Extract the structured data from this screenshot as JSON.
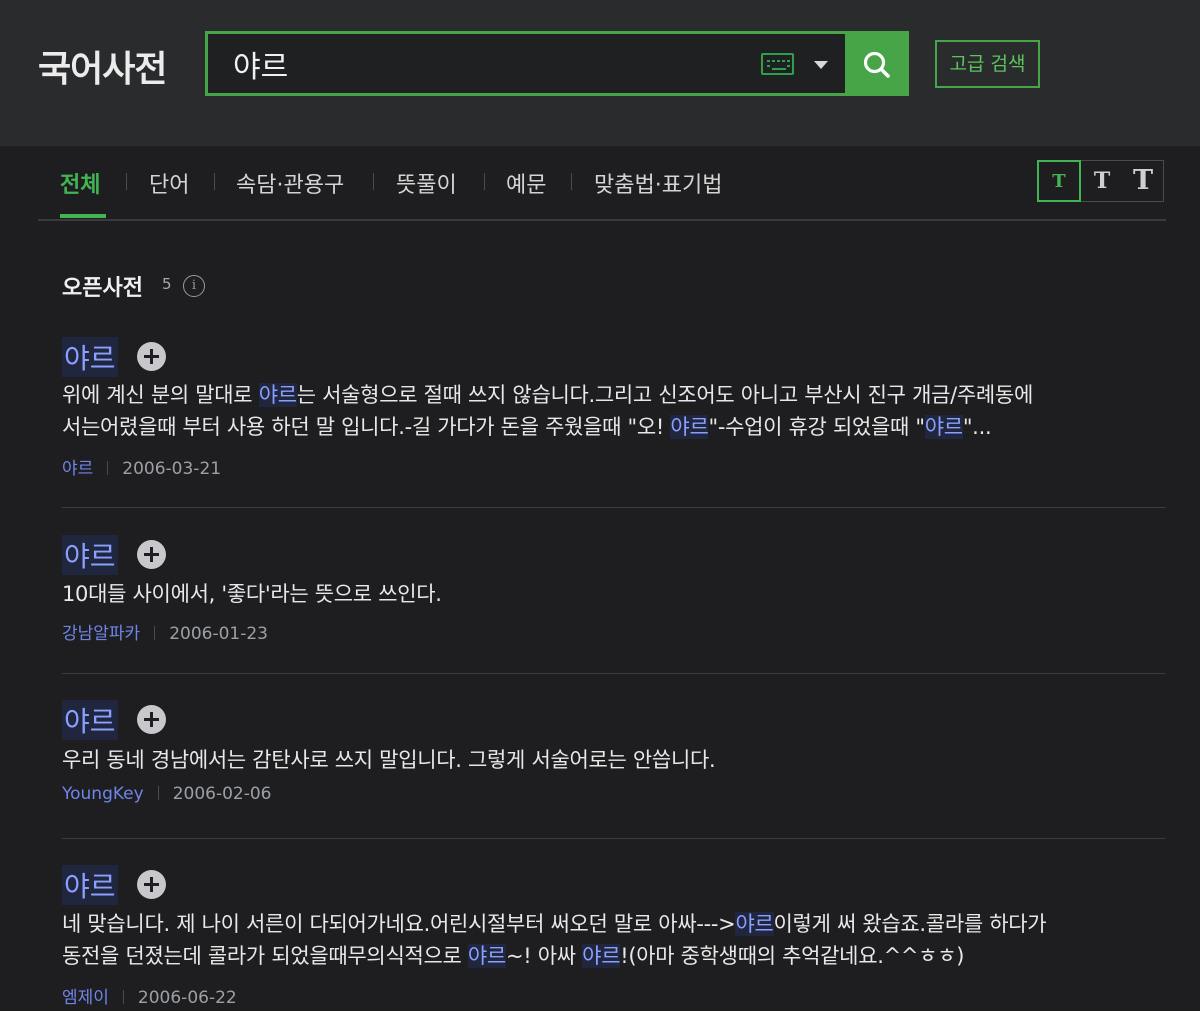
{
  "header": {
    "title": "국어사전",
    "search_value": "야르",
    "advanced_label": "고급 검색"
  },
  "tabs": [
    {
      "label": "전체",
      "active": true
    },
    {
      "label": "단어"
    },
    {
      "label": "속담·관용구"
    },
    {
      "label": "뜻풀이"
    },
    {
      "label": "예문"
    },
    {
      "label": "맞춤법·표기법"
    }
  ],
  "font_size_buttons": [
    "T",
    "T",
    "T"
  ],
  "section": {
    "title": "오픈사전",
    "count": "5",
    "info": "i"
  },
  "entries": [
    {
      "word": "야르",
      "desc_lines": [
        [
          {
            "t": "위에 계신 분의 말대로 "
          },
          {
            "t": "야르",
            "h": 1
          },
          {
            "t": "는 서술형으로 절때 쓰지 않습니다.그리고 신조어도 아니고 부산시 진구 개금/주례동에"
          }
        ],
        [
          {
            "t": "서는어렸을때 부터 사용 하던 말 입니다.-길 가다가 돈을 주웠을때 \"오! "
          },
          {
            "t": "야르",
            "h": 1
          },
          {
            "t": "\"-수업이 휴강 되었을때 \""
          },
          {
            "t": "야르",
            "h": 1
          },
          {
            "t": "\"..."
          }
        ]
      ],
      "author": "야르",
      "date": "2006-03-21"
    },
    {
      "word": "야르",
      "desc_lines": [
        [
          {
            "t": "10대들 사이에서, '좋다'라는 뜻으로 쓰인다."
          }
        ]
      ],
      "author": "강남알파카",
      "date": "2006-01-23"
    },
    {
      "word": "야르",
      "desc_lines": [
        [
          {
            "t": "우리 동네 경남에서는 감탄사로 쓰지 말입니다. 그렇게 서술어로는 안씁니다."
          }
        ]
      ],
      "author": "YoungKey",
      "date": "2006-02-06"
    },
    {
      "word": "야르",
      "desc_lines": [
        [
          {
            "t": "네 맞습니다. 제 나이 서른이 다되어가네요.어린시절부터 써오던 말로 아싸--->"
          },
          {
            "t": "야르",
            "h": 1
          },
          {
            "t": "이렇게 써 왔습죠.콜라를 하다가"
          }
        ],
        [
          {
            "t": "동전을 던졌는데 콜라가 되었을때무의식적으로 "
          },
          {
            "t": "야르",
            "h": 1
          },
          {
            "t": "~! 아싸 "
          },
          {
            "t": "야르",
            "h": 1
          },
          {
            "t": "!(아마 중학생때의 추억같네요.^^ㅎㅎ)"
          }
        ]
      ],
      "author": "엠제이",
      "date": "2006-06-22"
    }
  ]
}
